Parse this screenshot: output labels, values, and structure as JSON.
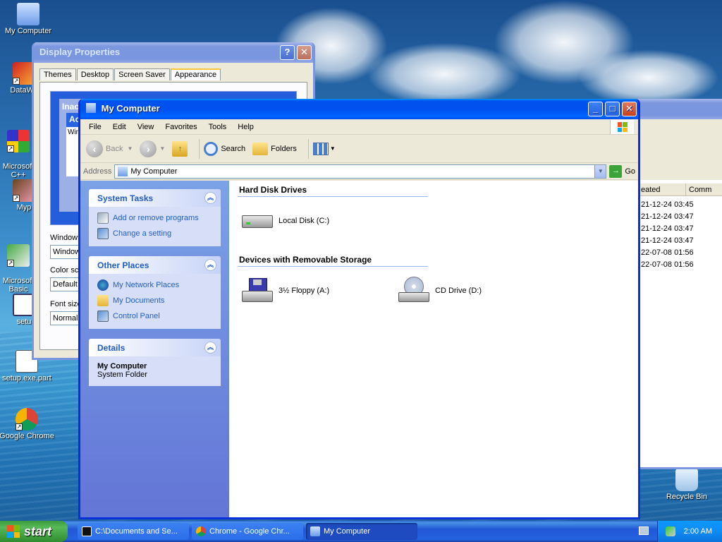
{
  "desktop": {
    "icons": [
      {
        "label": "My Computer"
      },
      {
        "label": "DataWa"
      },
      {
        "label": "Microsoft\nC++"
      },
      {
        "label": "Myp"
      },
      {
        "label": "Microsoft\nBasic"
      },
      {
        "label": "setu"
      },
      {
        "label": "setup.exe.part"
      },
      {
        "label": "Google Chrome"
      },
      {
        "label": "Recycle Bin"
      }
    ]
  },
  "display_properties": {
    "title": "Display Properties",
    "tabs": [
      "Themes",
      "Desktop",
      "Screen Saver",
      "Appearance"
    ],
    "active_tab": "Appearance",
    "preview_inactive": "Inac",
    "preview_active": "Ac",
    "preview_window": "Win",
    "label_windows": "Windows",
    "value_windows": "Window",
    "label_color": "Color sch",
    "value_color": "Default",
    "label_font": "Font size",
    "value_font": "Normal"
  },
  "background_window": {
    "col_created": "eated",
    "col_comment": "Comm",
    "rows": [
      "21-12-24 03:45",
      "21-12-24 03:47",
      "21-12-24 03:47",
      "21-12-24 03:47",
      "22-07-08 01:56",
      "22-07-08 01:56"
    ]
  },
  "my_computer": {
    "title": "My Computer",
    "menu": [
      "File",
      "Edit",
      "View",
      "Favorites",
      "Tools",
      "Help"
    ],
    "toolbar": {
      "back": "Back",
      "search": "Search",
      "folders": "Folders"
    },
    "address": {
      "label": "Address",
      "value": "My Computer",
      "go": "Go"
    },
    "tasks": {
      "system": {
        "title": "System Tasks",
        "links": [
          "Add or remove programs",
          "Change a setting"
        ]
      },
      "other": {
        "title": "Other Places",
        "links": [
          "My Network Places",
          "My Documents",
          "Control Panel"
        ]
      },
      "details": {
        "title": "Details",
        "name": "My Computer",
        "type": "System Folder"
      }
    },
    "groups": {
      "hdd": {
        "title": "Hard Disk Drives",
        "items": [
          "Local Disk (C:)"
        ]
      },
      "removable": {
        "title": "Devices with Removable Storage",
        "items": [
          "3½ Floppy (A:)",
          "CD Drive (D:)"
        ]
      }
    }
  },
  "taskbar": {
    "start": "start",
    "buttons": [
      "C:\\Documents and Se...",
      "Chrome - Google Chr...",
      "My Computer"
    ],
    "clock": "2:00 AM"
  },
  "colors": {
    "titlebar": "#0053ee",
    "taskpane": "#6375d6",
    "link": "#215dc6",
    "start": "#3c9a3c"
  }
}
